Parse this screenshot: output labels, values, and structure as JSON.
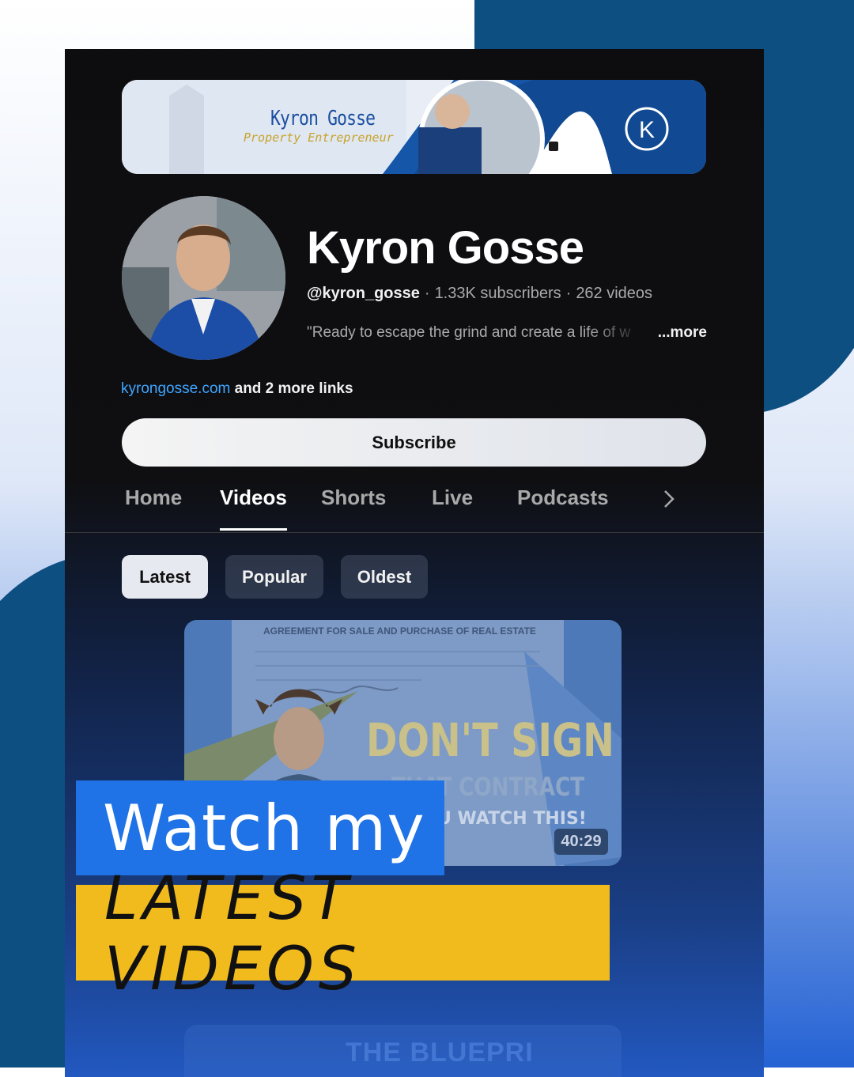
{
  "banner": {
    "name": "Kyron Gosse",
    "tagline": "Property Entrepreneur",
    "logo_icon": "k-circle-logo-icon"
  },
  "channel": {
    "name": "Kyron Gosse",
    "handle": "@kyron_gosse",
    "subscribers": "1.33K subscribers",
    "videos": "262 videos",
    "description": "\"Ready to escape the grind and create a life of w",
    "more": "...more",
    "link": "kyrongosse.com",
    "more_links": "and 2 more links"
  },
  "subscribe_label": "Subscribe",
  "tabs": [
    {
      "label": "Home",
      "active": false
    },
    {
      "label": "Videos",
      "active": true
    },
    {
      "label": "Shorts",
      "active": false
    },
    {
      "label": "Live",
      "active": false
    },
    {
      "label": "Podcasts",
      "active": false
    }
  ],
  "filters": [
    {
      "label": "Latest",
      "active": true
    },
    {
      "label": "Popular",
      "active": false
    },
    {
      "label": "Oldest",
      "active": false
    }
  ],
  "video": {
    "doc_heading": "AGREEMENT FOR SALE AND PURCHASE OF REAL ESTATE",
    "headline": "DON'T SIGN",
    "subline": "THAT CONTRACT",
    "subline2": "U WATCH THIS!",
    "duration": "40:29"
  },
  "video2": {
    "title": "THE BLUEPRI"
  },
  "overlay": {
    "line1": "Watch my",
    "line2": "LATEST VIDEOS"
  },
  "colors": {
    "accent_blue": "#1f73e6",
    "accent_yellow": "#f2bb1d",
    "bg_navy": "#0e4f82",
    "link_blue": "#3ea6ff"
  }
}
